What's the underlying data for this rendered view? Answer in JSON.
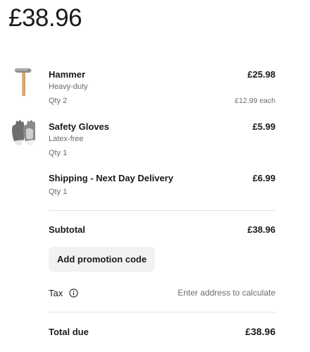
{
  "summary": {
    "total": "£38.96"
  },
  "items": [
    {
      "name": "Hammer",
      "description": "Heavy-duty",
      "qty": "Qty 2",
      "price": "£25.98",
      "unit_price": "£12.99 each",
      "icon": "hammer-image"
    },
    {
      "name": "Safety Gloves",
      "description": "Latex-free",
      "qty": "Qty 1",
      "price": "£5.99",
      "icon": "gloves-image"
    },
    {
      "name": "Shipping - Next Day Delivery",
      "qty": "Qty 1",
      "price": "£6.99"
    }
  ],
  "subtotal": {
    "label": "Subtotal",
    "value": "£38.96"
  },
  "promo": {
    "label": "Add promotion code"
  },
  "tax": {
    "label": "Tax",
    "value": "Enter address to calculate",
    "icon": "info-icon"
  },
  "total_due": {
    "label": "Total due",
    "value": "£38.96"
  },
  "colors": {
    "text": "#1a1a1a",
    "muted": "#6b6b6b",
    "divider": "#e3e3e3",
    "button_bg": "#f2f2f2"
  }
}
